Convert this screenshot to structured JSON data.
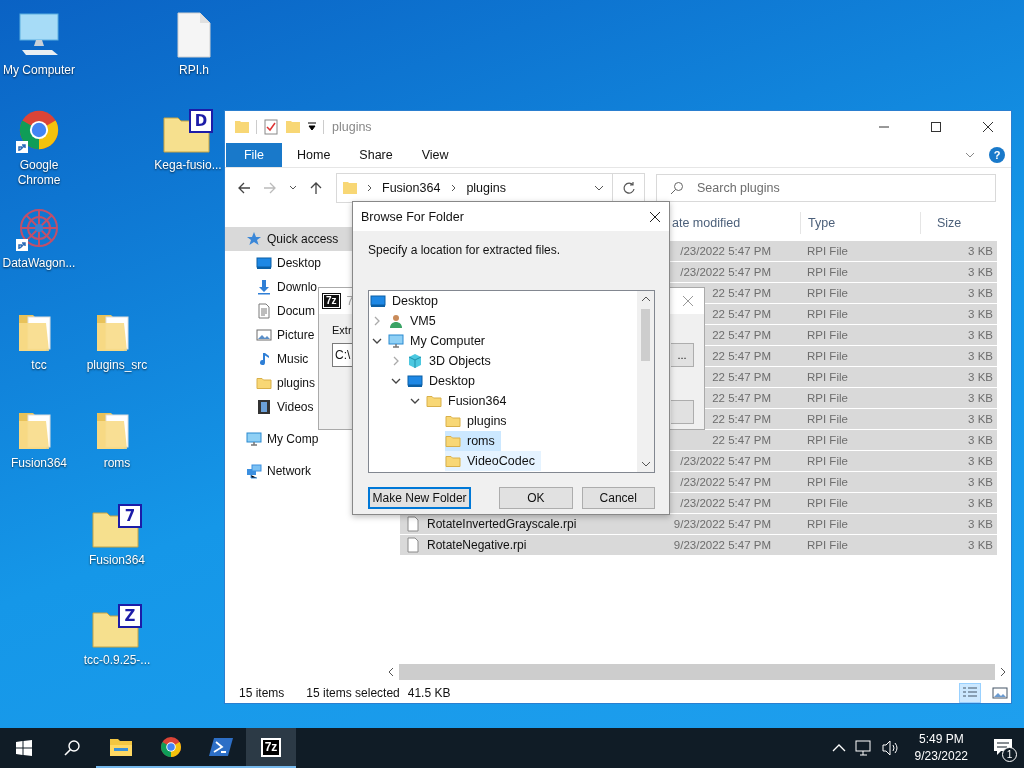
{
  "desktop": {
    "icons": [
      {
        "label": "My Computer",
        "kind": "computer",
        "shortcut": false
      },
      {
        "label": "RPI.h",
        "kind": "document",
        "shortcut": false
      },
      {
        "label": "Google Chrome",
        "kind": "chrome",
        "shortcut": true
      },
      {
        "label": "Kega-fusio...",
        "kind": "archive",
        "badge": "D",
        "shortcut": false
      },
      {
        "label": "DataWagon...",
        "kind": "pattern",
        "shortcut": true
      },
      {
        "label": "tcc",
        "kind": "folder",
        "shortcut": false
      },
      {
        "label": "plugins_src",
        "kind": "folder",
        "shortcut": false
      },
      {
        "label": "Fusion364",
        "kind": "folder",
        "shortcut": false
      },
      {
        "label": "roms",
        "kind": "folder",
        "shortcut": false
      },
      {
        "label": "Fusion364",
        "kind": "archive",
        "badge": "7",
        "shortcut": false
      },
      {
        "label": "tcc-0.9.25-...",
        "kind": "archive",
        "badge": "Z",
        "shortcut": false
      }
    ]
  },
  "explorer": {
    "title": "plugins",
    "file_menu": "File",
    "ribbon_tabs": [
      "Home",
      "Share",
      "View"
    ],
    "help": "?",
    "breadcrumb": [
      "Fusion364",
      "plugins"
    ],
    "search_placeholder": "Search plugins",
    "nav": [
      {
        "label": "Quick access",
        "kind": "star",
        "selected": true,
        "children": [
          {
            "label": "Desktop",
            "kind": "desktop",
            "selected": false
          },
          {
            "label": "Downlo",
            "kind": "download",
            "selected": false
          },
          {
            "label": "Docum",
            "kind": "document",
            "selected": false
          },
          {
            "label": "Picture",
            "kind": "pictures",
            "selected": false
          },
          {
            "label": "Music",
            "kind": "music",
            "selected": false
          },
          {
            "label": "plugins",
            "kind": "folder",
            "selected": false
          },
          {
            "label": "Videos",
            "kind": "videos",
            "selected": false
          }
        ]
      },
      {
        "label": "My Comp",
        "kind": "computer",
        "selected": false
      },
      {
        "label": "Network",
        "kind": "network",
        "selected": false
      }
    ],
    "columns": [
      "ate modified",
      "Type",
      "Size"
    ],
    "rows": [
      {
        "date": "/23/2022 5:47 PM",
        "type": "RPI File",
        "size": "3 KB",
        "selected": true
      },
      {
        "date": "/23/2022 5:47 PM",
        "type": "RPI File",
        "size": "3 KB",
        "selected": true
      },
      {
        "date": "22 5:47 PM",
        "type": "RPI File",
        "size": "3 KB",
        "selected": true
      },
      {
        "date": "22 5:47 PM",
        "type": "RPI File",
        "size": "3 KB",
        "selected": true
      },
      {
        "date": "22 5:47 PM",
        "type": "RPI File",
        "size": "3 KB",
        "selected": true
      },
      {
        "date": "22 5:47 PM",
        "type": "RPI File",
        "size": "3 KB",
        "selected": true
      },
      {
        "date": "22 5:47 PM",
        "type": "RPI File",
        "size": "3 KB",
        "selected": true
      },
      {
        "date": "22 5:47 PM",
        "type": "RPI File",
        "size": "3 KB",
        "selected": true
      },
      {
        "date": "22 5:47 PM",
        "type": "RPI File",
        "size": "3 KB",
        "selected": true
      },
      {
        "date": "22 5:47 PM",
        "type": "RPI File",
        "size": "3 KB",
        "selected": true
      },
      {
        "date": "/23/2022 5:47 PM",
        "type": "RPI File",
        "size": "3 KB",
        "selected": true
      },
      {
        "date": "/23/2022 5:47 PM",
        "type": "RPI File",
        "size": "3 KB",
        "selected": true
      },
      {
        "date": "/23/2022 5:47 PM",
        "type": "RPI File",
        "size": "3 KB",
        "selected": true
      },
      {
        "name": "RotateInvertedGrayscale.rpi",
        "date": "9/23/2022 5:47 PM",
        "type": "RPI File",
        "size": "3 KB",
        "selected": true
      },
      {
        "name": "RotateNegative.rpi",
        "date": "9/23/2022 5:47 PM",
        "type": "RPI File",
        "size": "3 KB",
        "selected": true
      }
    ],
    "status": {
      "count": "15 items",
      "selected": "15 items selected",
      "size": "41.5 KB"
    },
    "views": [
      {
        "kind": "details",
        "selected": true
      },
      {
        "kind": "large",
        "selected": false
      }
    ]
  },
  "sevenzip": {
    "icon": "7z",
    "title": "7",
    "label": "Extr",
    "path": "C:\\",
    "browse_button": "..."
  },
  "browse": {
    "title": "Browse For Folder",
    "prompt": "Specify a location for extracted files.",
    "tree": [
      {
        "label": "Desktop",
        "kind": "desktop",
        "selected": false,
        "hovered": false,
        "children": [
          {
            "label": "VM5",
            "kind": "user",
            "expanded": false,
            "selected": false,
            "hovered": false
          },
          {
            "label": "My Computer",
            "kind": "computer",
            "expanded": true,
            "selected": false,
            "hovered": false,
            "children": [
              {
                "label": "3D Objects",
                "kind": "cube",
                "expanded": false,
                "selected": false,
                "hovered": false
              },
              {
                "label": "Desktop",
                "kind": "desktop",
                "expanded": true,
                "selected": false,
                "hovered": false,
                "children": [
                  {
                    "label": "Fusion364",
                    "kind": "folder",
                    "expanded": true,
                    "selected": false,
                    "hovered": false,
                    "children": [
                      {
                        "label": "plugins",
                        "kind": "folder",
                        "selected": false,
                        "hovered": false
                      },
                      {
                        "label": "roms",
                        "kind": "folder",
                        "selected": true,
                        "hovered": false
                      },
                      {
                        "label": "VideoCodec",
                        "kind": "folder",
                        "selected": false,
                        "hovered": true
                      }
                    ]
                  }
                ]
              }
            ]
          }
        ]
      }
    ],
    "buttons": [
      {
        "label": "Make New Folder",
        "default": true
      },
      {
        "label": "OK",
        "default": false
      },
      {
        "label": "Cancel",
        "default": false
      }
    ]
  },
  "taskbar": {
    "apps": [
      {
        "kind": "explorer",
        "running": true,
        "active": false
      },
      {
        "kind": "chrome",
        "running": true,
        "active": false
      },
      {
        "kind": "powershell",
        "running": true,
        "active": false
      },
      {
        "kind": "sevenzip",
        "label": "7z",
        "running": true,
        "active": true
      }
    ],
    "time": "5:49 PM",
    "date": "9/23/2022",
    "notifications": "1"
  }
}
